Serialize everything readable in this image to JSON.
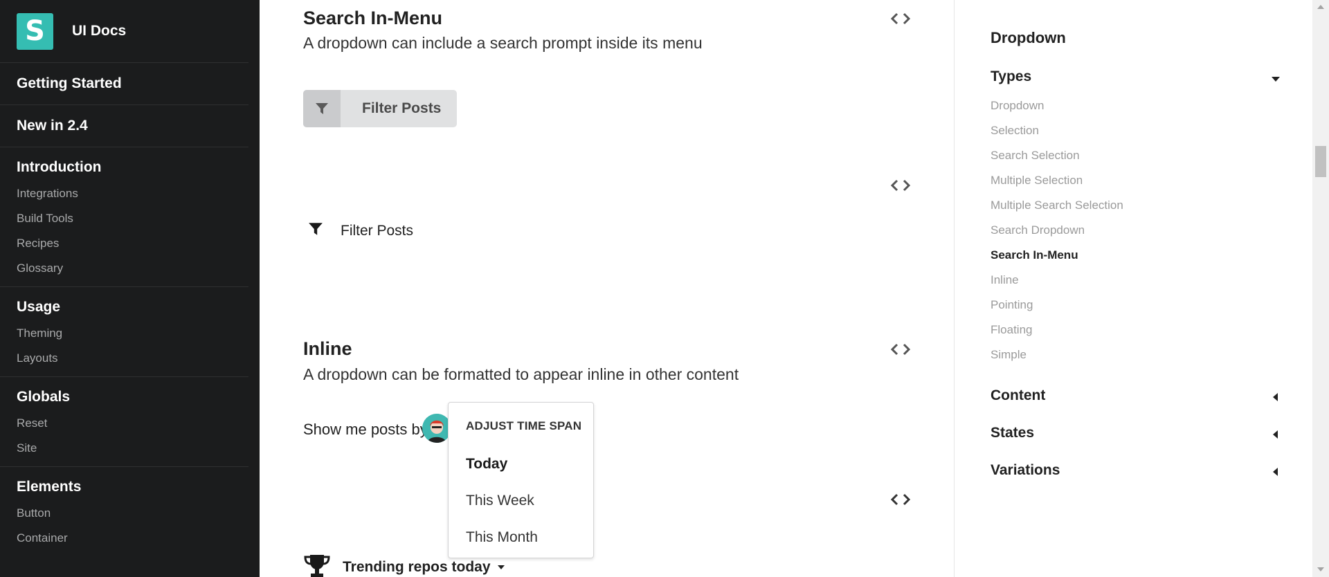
{
  "brand": {
    "logo_letter": "S",
    "name": "UI Docs",
    "color": "#35bdb2"
  },
  "sidebar": {
    "groups": [
      {
        "title": "Getting Started",
        "items": []
      },
      {
        "title": "New in 2.4",
        "items": []
      },
      {
        "title": "Introduction",
        "items": [
          "Integrations",
          "Build Tools",
          "Recipes",
          "Glossary"
        ]
      },
      {
        "title": "Usage",
        "items": [
          "Theming",
          "Layouts"
        ]
      },
      {
        "title": "Globals",
        "items": [
          "Reset",
          "Site"
        ]
      },
      {
        "title": "Elements",
        "items": [
          "Button",
          "Container"
        ]
      }
    ]
  },
  "main": {
    "search_in_menu": {
      "title": "Search In-Menu",
      "description": "A dropdown can include a search prompt inside its menu",
      "button_label": "Filter Posts",
      "plain_label": "Filter Posts"
    },
    "inline": {
      "title": "Inline",
      "description": "A dropdown can be formatted to appear inline in other content",
      "sentence": "Show me posts by",
      "menu": {
        "header": "ADJUST TIME SPAN",
        "items": [
          "Today",
          "This Week",
          "This Month"
        ],
        "active": "Today"
      }
    },
    "trending": {
      "label": "Trending repos today"
    }
  },
  "rail": {
    "title": "Dropdown",
    "sections": [
      {
        "label": "Types",
        "expanded": true,
        "items": [
          "Dropdown",
          "Selection",
          "Search Selection",
          "Multiple Selection",
          "Multiple Search Selection",
          "Search Dropdown",
          "Search In-Menu",
          "Inline",
          "Pointing",
          "Floating",
          "Simple"
        ],
        "active": "Search In-Menu"
      },
      {
        "label": "Content",
        "expanded": false
      },
      {
        "label": "States",
        "expanded": false
      },
      {
        "label": "Variations",
        "expanded": false
      }
    ]
  },
  "icons": [
    "filter-icon",
    "code-icon",
    "trophy-icon",
    "caret-down-icon",
    "caret-left-icon"
  ],
  "colors": {
    "sidebar_bg": "#1b1c1d",
    "button_bg": "#e0e1e2",
    "muted_text": "#9a9a9a"
  }
}
